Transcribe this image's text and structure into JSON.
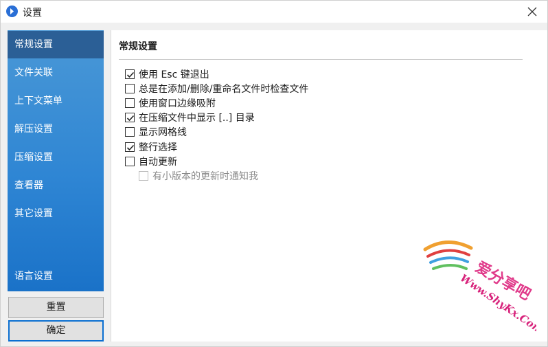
{
  "window": {
    "title": "设置"
  },
  "sidebar": {
    "items": [
      {
        "label": "常规设置",
        "active": true
      },
      {
        "label": "文件关联",
        "active": false
      },
      {
        "label": "上下文菜单",
        "active": false
      },
      {
        "label": "解压设置",
        "active": false
      },
      {
        "label": "压缩设置",
        "active": false
      },
      {
        "label": "查看器",
        "active": false
      },
      {
        "label": "其它设置",
        "active": false
      },
      {
        "label": "语言设置",
        "active": false
      }
    ]
  },
  "buttons": {
    "reset": "重置",
    "ok": "确定"
  },
  "content": {
    "title": "常规设置",
    "options": [
      {
        "label": "使用 Esc 键退出",
        "checked": true,
        "disabled": false
      },
      {
        "label": "总是在添加/删除/重命名文件时检查文件",
        "checked": false,
        "disabled": false
      },
      {
        "label": "使用窗口边缘吸附",
        "checked": false,
        "disabled": false
      },
      {
        "label": "在压缩文件中显示 [..] 目录",
        "checked": true,
        "disabled": false
      },
      {
        "label": "显示网格线",
        "checked": false,
        "disabled": false
      },
      {
        "label": "整行选择",
        "checked": true,
        "disabled": false
      },
      {
        "label": "自动更新",
        "checked": false,
        "disabled": false
      },
      {
        "label": "有小版本的更新时通知我",
        "checked": false,
        "disabled": true
      }
    ]
  },
  "watermark": {
    "cn": "爱分享吧",
    "en": "Www.ShyKx.Com"
  }
}
